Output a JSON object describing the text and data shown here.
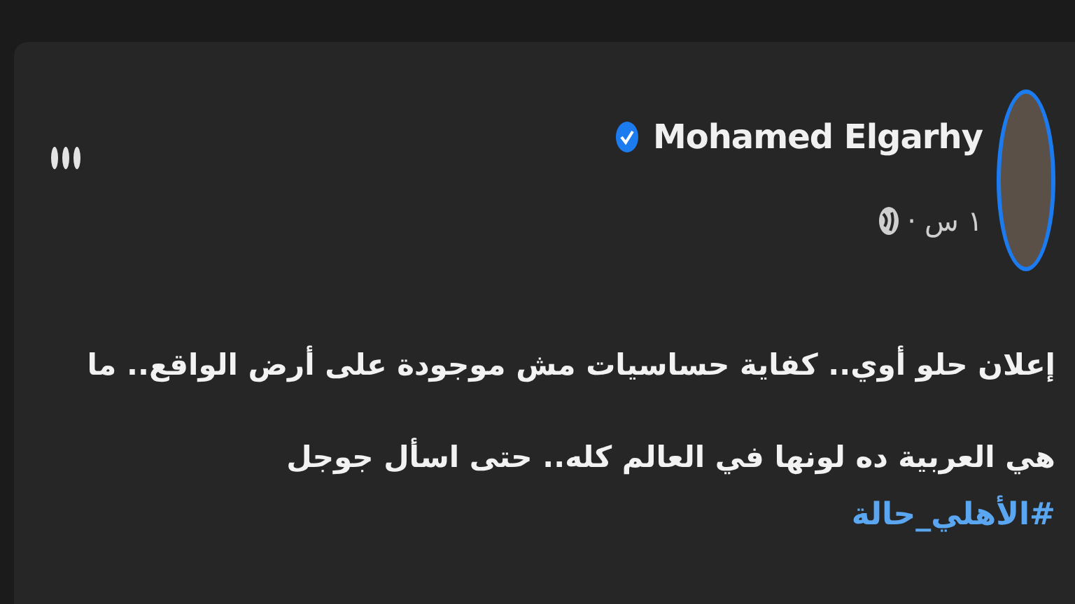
{
  "post": {
    "author": "Mohamed Elgarhy",
    "verified": true,
    "time": "١ س",
    "separator": "·",
    "text": "إعلان حلو أوي.. كفاية حساسيات مش موجودة على أرض الواقع.. ما هي العربية ده لونها في العالم كله.. حتى اسأل جوجل",
    "hashtag": "#الأهلي_حالة"
  }
}
